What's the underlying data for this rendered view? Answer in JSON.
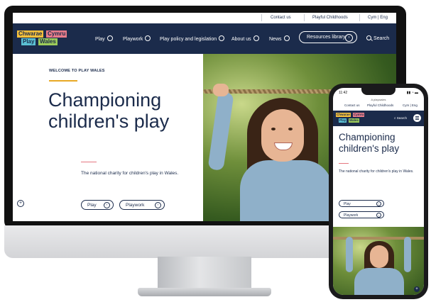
{
  "utility_nav": {
    "contact": "Contact us",
    "playful": "Playful Childhoods",
    "language": "Cym | Eng"
  },
  "logo": {
    "word1": "Chwarae",
    "word2": "Cymru",
    "word3": "Play",
    "word4": "Wales",
    "colors": [
      "#f5c03b",
      "#e87c8a",
      "#5bc1d4",
      "#9ccb5a"
    ]
  },
  "main_nav": {
    "items": [
      "Play",
      "Playwork",
      "Play policy and legislation",
      "About us",
      "News"
    ],
    "resources": "Resources library",
    "search": "Search"
  },
  "hero": {
    "eyebrow": "WELCOME TO PLAY WALES",
    "headline_line1": "Championing",
    "headline_line2": "children's play",
    "tagline": "The national charity for children's play in Wales.",
    "buttons": [
      "Play",
      "Playwork"
    ]
  },
  "phone": {
    "time": "11:42",
    "signal": "▮▮ ◔ ▬",
    "url": "A playwales",
    "utility": [
      "Contact us",
      "Playful Childhoods",
      "Cym | Eng"
    ],
    "search": "Search",
    "headline_line1": "Championing",
    "headline_line2": "children's play",
    "tagline": "The national charity for children's play in Wales.",
    "buttons": [
      "Play",
      "Playwork"
    ]
  },
  "colors": {
    "navy": "#1b2b4b",
    "gold_accent": "#e8a825",
    "pink_accent": "#e57780"
  },
  "icons": {
    "chevron": "chevron-down-icon",
    "arrow": "arrow-right-circle-icon",
    "search": "search-icon",
    "menu": "hamburger-menu-icon",
    "expand": "plus-circle-icon"
  }
}
